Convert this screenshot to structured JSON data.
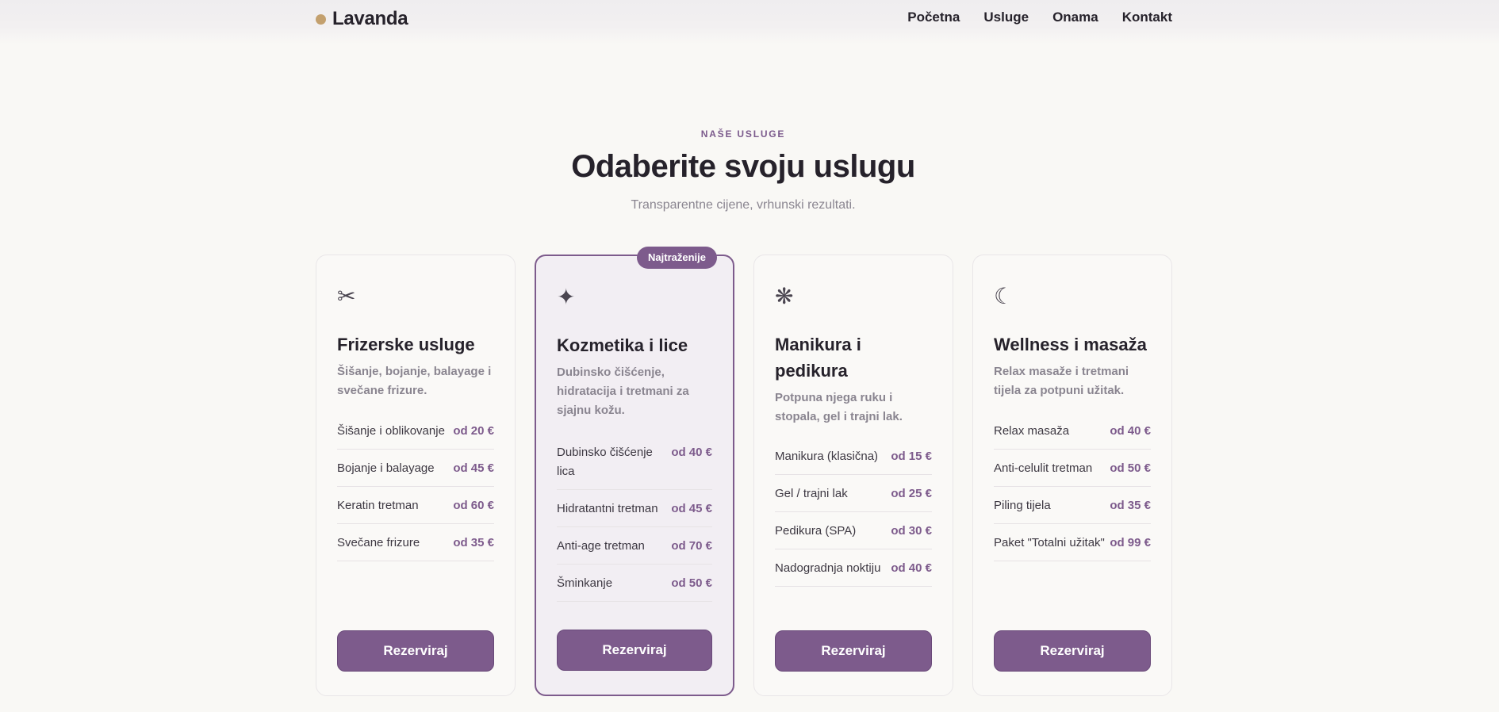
{
  "header": {
    "brand": "Lavanda",
    "nav": [
      "Početna",
      "Usluge",
      "Onama",
      "Kontakt"
    ]
  },
  "intro": {
    "eyebrow": "NAŠE USLUGE",
    "title": "Odaberite svoju uslugu",
    "subtitle": "Transparentne cijene, vrhunski rezultati."
  },
  "colors": {
    "accent": "#7d5b8c",
    "brand_dot": "#c3a06e",
    "background": "#f9f8f5"
  },
  "cards": [
    {
      "icon": "✂",
      "icon_name": "scissors-icon",
      "title": "Frizerske usluge",
      "desc": "Šišanje, bojanje, balayage i svečane frizure.",
      "items": [
        {
          "name": "Šišanje i oblikovanje",
          "price": "od 20 €"
        },
        {
          "name": "Bojanje i balayage",
          "price": "od 45 €"
        },
        {
          "name": "Keratin tretman",
          "price": "od 60 €"
        },
        {
          "name": "Svečane frizure",
          "price": "od 35 €"
        }
      ],
      "button": "Rezerviraj"
    },
    {
      "icon": "✦",
      "icon_name": "sparkle-icon",
      "badge": "Najtraženije",
      "title": "Kozmetika i lice",
      "desc": "Dubinsko čišćenje, hidratacija i tretmani za sjajnu kožu.",
      "items": [
        {
          "name": "Dubinsko čišćenje lica",
          "price": "od 40 €"
        },
        {
          "name": "Hidratantni tretman",
          "price": "od 45 €"
        },
        {
          "name": "Anti-age tretman",
          "price": "od 70 €"
        },
        {
          "name": "Šminkanje",
          "price": "od 50 €"
        }
      ],
      "button": "Rezerviraj"
    },
    {
      "icon": "❋",
      "icon_name": "flower-icon",
      "title": "Manikura i pedikura",
      "desc": "Potpuna njega ruku i stopala, gel i trajni lak.",
      "items": [
        {
          "name": "Manikura (klasična)",
          "price": "od 15 €"
        },
        {
          "name": "Gel / trajni lak",
          "price": "od 25 €"
        },
        {
          "name": "Pedikura (SPA)",
          "price": "od 30 €"
        },
        {
          "name": "Nadogradnja noktiju",
          "price": "od 40 €"
        }
      ],
      "button": "Rezerviraj"
    },
    {
      "icon": "☾",
      "icon_name": "moon-icon",
      "title": "Wellness i masaža",
      "desc": "Relax masaže i tretmani tijela za potpuni užitak.",
      "items": [
        {
          "name": "Relax masaža",
          "price": "od 40 €"
        },
        {
          "name": "Anti-celulit tretman",
          "price": "od 50 €"
        },
        {
          "name": "Piling tijela",
          "price": "od 35 €"
        },
        {
          "name": "Paket \"Totalni užitak\"",
          "price": "od 99 €"
        }
      ],
      "button": "Rezerviraj"
    }
  ]
}
